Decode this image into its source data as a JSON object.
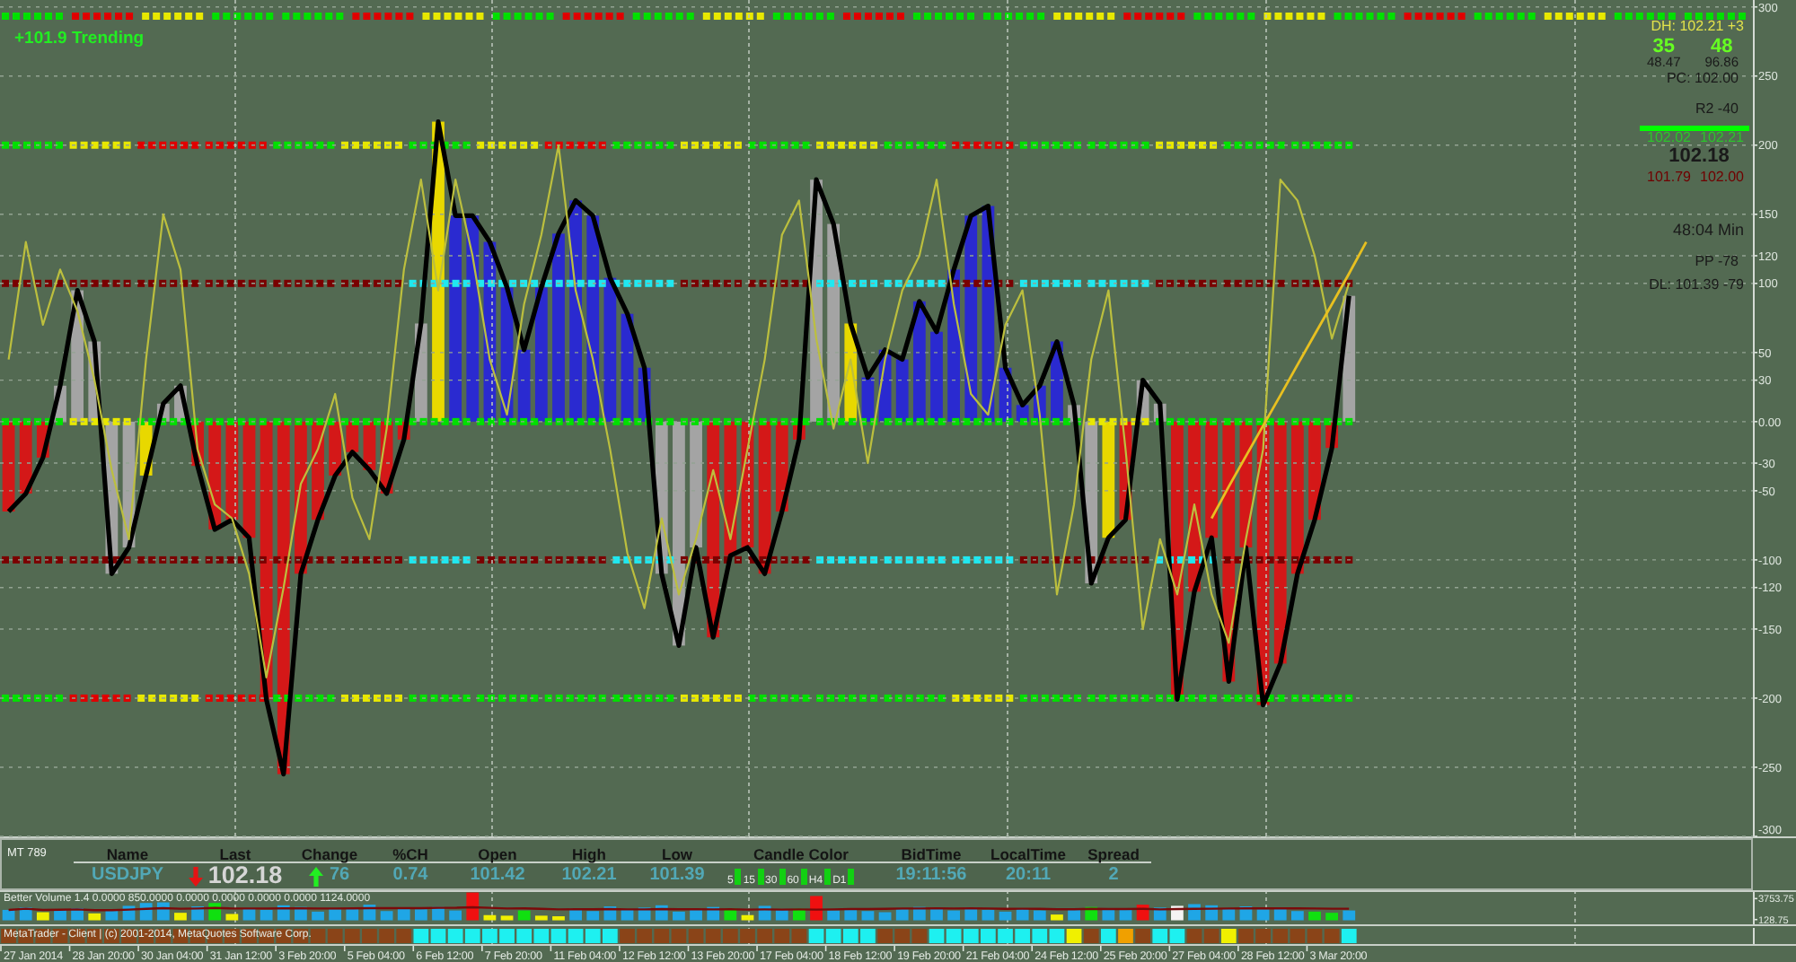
{
  "main_chart": {
    "status_text": "+101.9 Trending",
    "signal_strip": [
      {
        "color": "#00e000"
      },
      {
        "color": "#e00000"
      },
      {
        "color": "#e8e800"
      },
      {
        "color": "#00e000"
      },
      {
        "color": "#00e000"
      },
      {
        "color": "#e00000"
      },
      {
        "color": "#e8e800"
      },
      {
        "color": "#00e000"
      },
      {
        "color": "#e00000"
      },
      {
        "color": "#00e000"
      },
      {
        "color": "#e8e800"
      },
      {
        "color": "#00e000"
      },
      {
        "color": "#e00000"
      },
      {
        "color": "#00e000"
      },
      {
        "color": "#00e000"
      },
      {
        "color": "#e8e800"
      },
      {
        "color": "#e00000"
      },
      {
        "color": "#00e000"
      },
      {
        "color": "#e8e800"
      },
      {
        "color": "#00e000"
      },
      {
        "color": "#e00000"
      },
      {
        "color": "#00e000"
      },
      {
        "color": "#e8e800"
      },
      {
        "color": "#00e000"
      },
      {
        "color": "#00e000"
      }
    ],
    "level_strips": [
      {
        "segments": [
          {
            "color": "#00e000"
          },
          {
            "color": "#e8e800"
          },
          {
            "color": "#e00000"
          },
          {
            "color": "#e00000"
          },
          {
            "color": "#00e000"
          },
          {
            "color": "#e8e800"
          },
          {
            "color": "#00e000"
          },
          {
            "color": "#e8e800"
          },
          {
            "color": "#e00000"
          },
          {
            "color": "#00e000"
          },
          {
            "color": "#e8e800"
          },
          {
            "color": "#00e000"
          },
          {
            "color": "#e8e800"
          },
          {
            "color": "#00e000"
          },
          {
            "color": "#e00000"
          },
          {
            "color": "#00e000"
          },
          {
            "color": "#00e000"
          },
          {
            "color": "#e8e800"
          },
          {
            "color": "#00e000"
          },
          {
            "color": "#00e000"
          }
        ]
      },
      {
        "segments": [
          {
            "color": "#7a0000"
          },
          {
            "color": "#7a0000"
          },
          {
            "color": "#7a0000"
          },
          {
            "color": "#7a0000"
          },
          {
            "color": "#7a0000"
          },
          {
            "color": "#7a0000"
          },
          {
            "color": "#20e8f0"
          },
          {
            "color": "#20e8f0"
          },
          {
            "color": "#20e8f0"
          },
          {
            "color": "#20e8f0"
          },
          {
            "color": "#7a0000"
          },
          {
            "color": "#7a0000"
          },
          {
            "color": "#20e8f0"
          },
          {
            "color": "#20e8f0"
          },
          {
            "color": "#7a0000"
          },
          {
            "color": "#20e8f0"
          },
          {
            "color": "#20e8f0"
          },
          {
            "color": "#7a0000"
          },
          {
            "color": "#7a0000"
          },
          {
            "color": "#7a0000"
          }
        ]
      },
      {
        "segments": [
          {
            "color": "#00e000"
          },
          {
            "color": "#e8e800"
          },
          {
            "color": "#00e000"
          },
          {
            "color": "#00e000"
          },
          {
            "color": "#00e000"
          },
          {
            "color": "#00e000"
          },
          {
            "color": "#00e000"
          },
          {
            "color": "#00e000"
          },
          {
            "color": "#00e000"
          },
          {
            "color": "#00e000"
          },
          {
            "color": "#00e000"
          },
          {
            "color": "#00e000"
          },
          {
            "color": "#00e000"
          },
          {
            "color": "#00e000"
          },
          {
            "color": "#00e000"
          },
          {
            "color": "#00e000"
          },
          {
            "color": "#e8e800"
          },
          {
            "color": "#00e000"
          },
          {
            "color": "#00e000"
          },
          {
            "color": "#00e000"
          }
        ]
      },
      {
        "segments": [
          {
            "color": "#7a0000"
          },
          {
            "color": "#7a0000"
          },
          {
            "color": "#7a0000"
          },
          {
            "color": "#7a0000"
          },
          {
            "color": "#7a0000"
          },
          {
            "color": "#7a0000"
          },
          {
            "color": "#20e8f0"
          },
          {
            "color": "#7a0000"
          },
          {
            "color": "#7a0000"
          },
          {
            "color": "#20e8f0"
          },
          {
            "color": "#7a0000"
          },
          {
            "color": "#7a0000"
          },
          {
            "color": "#20e8f0"
          },
          {
            "color": "#20e8f0"
          },
          {
            "color": "#20e8f0"
          },
          {
            "color": "#7a0000"
          },
          {
            "color": "#7a0000"
          },
          {
            "color": "#20e8f0"
          },
          {
            "color": "#7a0000"
          },
          {
            "color": "#7a0000"
          }
        ]
      },
      {
        "segments": [
          {
            "color": "#00e000"
          },
          {
            "color": "#e00000"
          },
          {
            "color": "#e8e800"
          },
          {
            "color": "#e00000"
          },
          {
            "color": "#00e000"
          },
          {
            "color": "#e8e800"
          },
          {
            "color": "#00e000"
          },
          {
            "color": "#00e000"
          },
          {
            "color": "#00e000"
          },
          {
            "color": "#00e000"
          },
          {
            "color": "#e8e800"
          },
          {
            "color": "#00e000"
          },
          {
            "color": "#00e000"
          },
          {
            "color": "#00e000"
          },
          {
            "color": "#e8e800"
          },
          {
            "color": "#00e000"
          },
          {
            "color": "#00e000"
          },
          {
            "color": "#00e000"
          },
          {
            "color": "#00e000"
          },
          {
            "color": "#00e000"
          }
        ]
      }
    ],
    "histogram": {
      "bars": [
        {
          "color": "#d41818"
        },
        {
          "color": "#d41818"
        },
        {
          "color": "#d41818"
        },
        {
          "color": "#a4a4a4"
        },
        {
          "color": "#a4a4a4"
        },
        {
          "color": "#a4a4a4"
        },
        {
          "color": "#a4a4a4"
        },
        {
          "color": "#a4a4a4"
        },
        {
          "color": "#e8d800"
        },
        {
          "color": "#a4a4a4"
        },
        {
          "color": "#a4a4a4"
        },
        {
          "color": "#d41818"
        },
        {
          "color": "#d41818"
        },
        {
          "color": "#d41818"
        },
        {
          "color": "#d41818"
        },
        {
          "color": "#d41818"
        },
        {
          "color": "#d41818"
        },
        {
          "color": "#d41818"
        },
        {
          "color": "#d41818"
        },
        {
          "color": "#d41818"
        },
        {
          "color": "#d41818"
        },
        {
          "color": "#d41818"
        },
        {
          "color": "#d41818"
        },
        {
          "color": "#d41818"
        },
        {
          "color": "#a4a4a4"
        },
        {
          "color": "#e8d800"
        },
        {
          "color": "#2a2ad0"
        },
        {
          "color": "#2a2ad0"
        },
        {
          "color": "#2a2ad0"
        },
        {
          "color": "#2a2ad0"
        },
        {
          "color": "#2a2ad0"
        },
        {
          "color": "#2a2ad0"
        },
        {
          "color": "#2a2ad0"
        },
        {
          "color": "#2a2ad0"
        },
        {
          "color": "#2a2ad0"
        },
        {
          "color": "#2a2ad0"
        },
        {
          "color": "#2a2ad0"
        },
        {
          "color": "#2a2ad0"
        },
        {
          "color": "#a4a4a4"
        },
        {
          "color": "#a4a4a4"
        },
        {
          "color": "#a4a4a4"
        },
        {
          "color": "#d41818"
        },
        {
          "color": "#d41818"
        },
        {
          "color": "#d41818"
        },
        {
          "color": "#d41818"
        },
        {
          "color": "#d41818"
        },
        {
          "color": "#d41818"
        },
        {
          "color": "#a4a4a4"
        },
        {
          "color": "#a4a4a4"
        },
        {
          "color": "#e8d800"
        },
        {
          "color": "#2a2ad0"
        },
        {
          "color": "#2a2ad0"
        },
        {
          "color": "#2a2ad0"
        },
        {
          "color": "#2a2ad0"
        },
        {
          "color": "#2a2ad0"
        },
        {
          "color": "#2a2ad0"
        },
        {
          "color": "#2a2ad0"
        },
        {
          "color": "#2a2ad0"
        },
        {
          "color": "#2a2ad0"
        },
        {
          "color": "#2a2ad0"
        },
        {
          "color": "#2a2ad0"
        },
        {
          "color": "#2a2ad0"
        },
        {
          "color": "#a4a4a4"
        },
        {
          "color": "#a4a4a4"
        },
        {
          "color": "#e8d800"
        },
        {
          "color": "#d41818"
        },
        {
          "color": "#a4a4a4"
        },
        {
          "color": "#a4a4a4"
        },
        {
          "color": "#d41818"
        },
        {
          "color": "#d41818"
        },
        {
          "color": "#d41818"
        },
        {
          "color": "#d41818"
        },
        {
          "color": "#d41818"
        },
        {
          "color": "#d41818"
        },
        {
          "color": "#d41818"
        },
        {
          "color": "#d41818"
        },
        {
          "color": "#d41818"
        },
        {
          "color": "#d41818"
        },
        {
          "color": "#a4a4a4"
        }
      ]
    },
    "oscillator": {
      "chart_data": {
        "type": "line",
        "grid": true,
        "ylim": [
          -300,
          305
        ],
        "yticks": [
          300,
          250,
          200,
          150,
          120,
          100,
          50,
          30,
          {
            "value": 0,
            "label": "0.00"
          },
          -30,
          -50,
          -100,
          -120,
          -150,
          -200,
          -250,
          -300
        ],
        "categories": [
          null,
          null,
          null,
          null,
          null,
          null,
          null,
          null,
          null,
          null,
          null,
          null,
          null,
          null,
          null,
          null,
          null,
          null,
          null,
          null,
          null,
          null,
          null,
          null,
          null,
          null,
          null,
          null,
          null,
          null,
          null,
          null,
          null,
          null,
          null,
          null,
          null,
          null,
          null,
          null,
          null,
          null,
          null,
          null,
          null,
          null,
          null,
          null,
          null,
          null,
          null,
          null,
          null,
          null,
          null,
          null,
          null,
          null,
          null,
          null,
          null,
          null,
          null,
          null,
          null,
          null,
          null,
          null,
          null,
          null,
          null,
          null,
          null,
          null,
          null,
          null,
          null,
          null,
          null,
          null,
          null,
          null,
          null,
          null,
          null,
          null,
          null,
          null,
          null,
          null,
          null,
          null,
          null,
          null,
          null,
          null,
          null,
          null,
          null,
          null,
          null,
          null
        ],
        "series": [
          {
            "color": "#000000",
            "values": [
              -65,
              -52,
              -26,
              26,
              95,
              58,
              -110,
              -91,
              -39,
              13,
              26,
              -32,
              -78,
              -71,
              -84,
              -201,
              -255,
              -110,
              -71,
              -39,
              -22,
              -35,
              -52,
              -13,
              71,
              217,
              149,
              149,
              130,
              97,
              52,
              97,
              136,
              160,
              149,
              104,
              78,
              39,
              -110,
              -162,
              -91,
              -156,
              -97,
              -91,
              -110,
              -65,
              -13,
              175,
              143,
              71,
              32,
              52,
              45,
              87,
              65,
              110,
              149,
              156,
              39,
              12,
              26,
              58,
              12,
              -117,
              -84,
              -71,
              30,
              13,
              -201,
              -123,
              -84,
              -188,
              -91,
              -205,
              -175,
              -110,
              -71,
              -19,
              91,
              null,
              null,
              null,
              null,
              null,
              null,
              null,
              null,
              null,
              null,
              null,
              null,
              null,
              null,
              null,
              null,
              null,
              null,
              null,
              null,
              null,
              null,
              null
            ]
          },
          {
            "color": "#bcbf3e",
            "values": [
              45,
              130,
              70,
              110,
              80,
              30,
              -35,
              -85,
              45,
              150,
              110,
              -20,
              -60,
              -70,
              -110,
              -185,
              -120,
              -45,
              -20,
              20,
              -55,
              -85,
              -5,
              110,
              175,
              95,
              175,
              120,
              45,
              5,
              85,
              135,
              200,
              95,
              45,
              -20,
              -95,
              -135,
              -70,
              -125,
              -85,
              -35,
              -85,
              -20,
              45,
              135,
              160,
              60,
              -5,
              45,
              -30,
              45,
              95,
              120,
              175,
              85,
              20,
              5,
              70,
              95,
              5,
              -125,
              -60,
              45,
              95,
              -20,
              -150,
              -85,
              -125,
              -60,
              -125,
              -160,
              -85,
              -20,
              175,
              160,
              120,
              60,
              100,
              null,
              null,
              null,
              null,
              null,
              null,
              null,
              null,
              null,
              null,
              null,
              null,
              null,
              null,
              null,
              null,
              null,
              null,
              null,
              null,
              null,
              null,
              null
            ]
          },
          {
            "color": "#e8c020",
            "values": [
              null,
              null,
              null,
              null,
              null,
              null,
              null,
              null,
              null,
              null,
              null,
              null,
              null,
              null,
              null,
              null,
              null,
              null,
              null,
              null,
              null,
              null,
              null,
              null,
              null,
              null,
              null,
              null,
              null,
              null,
              null,
              null,
              null,
              null,
              null,
              null,
              null,
              null,
              null,
              null,
              null,
              null,
              null,
              null,
              null,
              null,
              null,
              null,
              null,
              null,
              null,
              null,
              null,
              null,
              null,
              null,
              null,
              null,
              null,
              null,
              null,
              null,
              null,
              null,
              null,
              null,
              null,
              null,
              null,
              null,
              -70,
              -47,
              -25,
              -3,
              19,
              41,
              63,
              85,
              107,
              130,
              null,
              null,
              null,
              null,
              null,
              null,
              null,
              null,
              null,
              null,
              null,
              null,
              null,
              null,
              null,
              null,
              null,
              null,
              null,
              null,
              null,
              null
            ]
          }
        ]
      }
    },
    "readout": {
      "day_high": "DH: 102.21 +3",
      "counters": [
        {
          "value": "35",
          "detail": "48.47"
        },
        {
          "value": "48",
          "detail": "96.86"
        }
      ],
      "previous_close": "PC: 102.00",
      "resistance": "R2 -40",
      "high_pair": [
        "102.02",
        "102.21"
      ],
      "price": "102.18",
      "low_pair": [
        "101.79",
        "102.00"
      ],
      "countdown": "48:04 Min",
      "pivot": "PP -78",
      "day_low": "DL: 101.39 -79"
    }
  },
  "quote_panel": {
    "terminal": "MT 789",
    "columns": [
      "Name",
      "Last",
      "Change",
      "%CH",
      "Open",
      "High",
      "Low",
      "Candle Color",
      "BidTime",
      "LocalTime",
      "Spread"
    ],
    "symbol": "USDJPY",
    "last_up": false,
    "last": "102.18",
    "change_up": true,
    "change": "76",
    "percent_change": "0.74",
    "open": "101.42",
    "high": "102.21",
    "low": "101.39",
    "candles": [
      {
        "label": "5",
        "color": "#12d012"
      },
      {
        "label": "15",
        "color": "#12d012"
      },
      {
        "label": "30",
        "color": "#12d012"
      },
      {
        "label": "60",
        "color": "#12d012"
      },
      {
        "label": "H4",
        "color": "#12d012"
      },
      {
        "label": "D1",
        "color": "#12d012"
      }
    ],
    "bid_time": "19:11:56",
    "local_time": "20:11",
    "spread": "2"
  },
  "volume_chart": {
    "title": "Better Volume 1.4 0.0000 850.0000 0.0000 0.0000 0.0000 0.0000 1124.0000",
    "chart_data": {
      "type": "bar",
      "stacked": true,
      "grid": true,
      "ylim": [
        -1000,
        5200
      ],
      "yticks": [
        3753.75,
        128.75
      ],
      "series": [
        {
          "color": "#1fa6e6",
          "values": [
            1800,
            2200,
            null,
            1900,
            2100,
            null,
            1700,
            2500,
            3000,
            3100,
            null,
            2400,
            null,
            null,
            2000,
            1800,
            2600,
            2300,
            1500,
            1900,
            2200,
            2700,
            1600,
            2100,
            1900,
            2300,
            1700,
            null,
            null,
            null,
            null,
            null,
            null,
            2100,
            1600,
            2400,
            1800,
            2200,
            2600,
            1500,
            2000,
            2300,
            null,
            null,
            2500,
            1900,
            null,
            null,
            1700,
            2100,
            1600,
            1400,
            1900,
            2300,
            2000,
            1700,
            2200,
            1800,
            1500,
            2000,
            1700,
            null,
            1900,
            null,
            1800,
            2000,
            null,
            2200,
            null,
            2800,
            2600,
            2100,
            2400,
            1900,
            2200,
            1600,
            null,
            null,
            1700,
            null,
            null,
            null,
            null,
            null,
            null,
            null,
            null,
            null,
            null,
            null,
            null,
            null,
            null,
            null,
            null,
            null,
            null,
            null,
            null,
            null,
            null,
            null
          ]
        },
        {
          "color": "#f0f000",
          "values": [
            null,
            null,
            1400,
            null,
            null,
            1200,
            null,
            null,
            null,
            null,
            1300,
            null,
            null,
            1100,
            null,
            null,
            null,
            null,
            null,
            null,
            null,
            null,
            null,
            null,
            null,
            null,
            null,
            null,
            900,
            800,
            null,
            800,
            700,
            null,
            null,
            null,
            null,
            null,
            null,
            null,
            null,
            null,
            null,
            900,
            null,
            null,
            null,
            null,
            null,
            null,
            null,
            null,
            null,
            null,
            null,
            null,
            null,
            null,
            null,
            null,
            null,
            1000,
            null,
            null,
            null,
            null,
            null,
            null,
            null,
            null,
            null,
            null,
            null,
            null,
            null,
            null,
            null,
            null,
            null,
            null,
            null,
            null,
            null,
            null,
            null,
            null,
            null,
            null,
            null,
            null,
            null,
            null,
            null,
            null,
            null,
            null,
            null,
            null,
            null,
            null,
            null,
            null
          ]
        },
        {
          "color": "#10e010",
          "values": [
            null,
            null,
            null,
            null,
            null,
            null,
            null,
            null,
            null,
            null,
            null,
            null,
            3000,
            null,
            null,
            null,
            null,
            null,
            null,
            null,
            null,
            null,
            null,
            null,
            null,
            null,
            null,
            null,
            null,
            null,
            1700,
            null,
            null,
            null,
            null,
            null,
            null,
            null,
            null,
            null,
            null,
            null,
            2100,
            null,
            null,
            null,
            2000,
            null,
            null,
            null,
            null,
            null,
            null,
            null,
            null,
            null,
            null,
            null,
            null,
            null,
            null,
            null,
            null,
            2300,
            null,
            null,
            null,
            null,
            null,
            null,
            null,
            null,
            null,
            null,
            null,
            null,
            1500,
            1300,
            null,
            null,
            null,
            null,
            null,
            null,
            null,
            null,
            null,
            null,
            null,
            null,
            null,
            null,
            null,
            null,
            null,
            null,
            null,
            null,
            null,
            null,
            null
          ]
        },
        {
          "color": "#f01010",
          "values": [
            null,
            null,
            null,
            null,
            null,
            null,
            null,
            null,
            null,
            null,
            null,
            null,
            null,
            null,
            null,
            null,
            null,
            null,
            null,
            null,
            null,
            null,
            null,
            null,
            null,
            null,
            null,
            4800,
            null,
            null,
            null,
            null,
            null,
            null,
            null,
            null,
            null,
            null,
            null,
            null,
            null,
            null,
            null,
            null,
            null,
            null,
            null,
            4200,
            null,
            null,
            null,
            null,
            null,
            null,
            null,
            null,
            null,
            null,
            null,
            null,
            null,
            null,
            null,
            null,
            null,
            null,
            2700,
            null,
            null,
            null,
            null,
            null,
            null,
            null,
            null,
            null,
            null,
            null,
            null,
            null,
            null,
            null,
            null,
            null,
            null,
            null,
            null,
            null,
            null,
            null,
            null,
            null,
            null,
            null,
            null,
            null,
            null,
            null,
            null,
            null,
            null,
            null
          ]
        },
        {
          "color": "#f4f4f4",
          "values": [
            null,
            null,
            null,
            null,
            null,
            null,
            null,
            null,
            null,
            null,
            null,
            null,
            null,
            null,
            null,
            null,
            null,
            null,
            null,
            null,
            null,
            null,
            null,
            null,
            null,
            null,
            null,
            null,
            null,
            null,
            null,
            null,
            null,
            null,
            null,
            null,
            null,
            null,
            null,
            null,
            null,
            null,
            null,
            null,
            null,
            null,
            null,
            null,
            null,
            null,
            null,
            null,
            null,
            null,
            null,
            null,
            null,
            null,
            null,
            null,
            null,
            null,
            null,
            null,
            null,
            null,
            null,
            null,
            2500,
            null,
            null,
            null,
            null,
            null,
            null,
            null,
            null,
            null,
            null,
            null,
            null,
            null,
            null,
            null,
            null,
            null,
            null,
            null,
            null,
            null,
            null,
            null,
            null,
            null,
            null,
            null,
            null,
            null,
            null,
            null,
            null,
            null
          ]
        }
      ]
    }
  },
  "color_strip": {
    "caption": "MetaTrader - Client | (c) 2001-2014, MetaQuotes Software Corp.",
    "blocks": [
      {
        "color": "#8a4418"
      },
      {
        "color": "#8a4418"
      },
      {
        "color": "#8a4418"
      },
      {
        "color": "#8a4418"
      },
      {
        "color": "#8a4418"
      },
      {
        "color": "#8a4418"
      },
      {
        "color": "#8a4418"
      },
      {
        "color": "#8a4418"
      },
      {
        "color": "#8a4418"
      },
      {
        "color": "#8a4418"
      },
      {
        "color": "#8a4418"
      },
      {
        "color": "#8a4418"
      },
      {
        "color": "#8a4418"
      },
      {
        "color": "#8a4418"
      },
      {
        "color": "#8a4418"
      },
      {
        "color": "#8a4418"
      },
      {
        "color": "#8a4418"
      },
      {
        "color": "#8a4418"
      },
      {
        "color": "#8a4418"
      },
      {
        "color": "#8a4418"
      },
      {
        "color": "#8a4418"
      },
      {
        "color": "#8a4418"
      },
      {
        "color": "#8a4418"
      },
      {
        "color": "#8a4418"
      },
      {
        "color": "#1ef0f0"
      },
      {
        "color": "#1ef0f0"
      },
      {
        "color": "#1ef0f0"
      },
      {
        "color": "#1ef0f0"
      },
      {
        "color": "#1ef0f0"
      },
      {
        "color": "#1ef0f0"
      },
      {
        "color": "#1ef0f0"
      },
      {
        "color": "#1ef0f0"
      },
      {
        "color": "#1ef0f0"
      },
      {
        "color": "#1ef0f0"
      },
      {
        "color": "#1ef0f0"
      },
      {
        "color": "#1ef0f0"
      },
      {
        "color": "#8a4418"
      },
      {
        "color": "#8a4418"
      },
      {
        "color": "#8a4418"
      },
      {
        "color": "#8a4418"
      },
      {
        "color": "#8a4418"
      },
      {
        "color": "#8a4418"
      },
      {
        "color": "#8a4418"
      },
      {
        "color": "#8a4418"
      },
      {
        "color": "#8a4418"
      },
      {
        "color": "#8a4418"
      },
      {
        "color": "#8a4418"
      },
      {
        "color": "#1ef0f0"
      },
      {
        "color": "#1ef0f0"
      },
      {
        "color": "#1ef0f0"
      },
      {
        "color": "#1ef0f0"
      },
      {
        "color": "#8a4418"
      },
      {
        "color": "#8a4418"
      },
      {
        "color": "#8a4418"
      },
      {
        "color": "#1ef0f0"
      },
      {
        "color": "#1ef0f0"
      },
      {
        "color": "#1ef0f0"
      },
      {
        "color": "#1ef0f0"
      },
      {
        "color": "#1ef0f0"
      },
      {
        "color": "#1ef0f0"
      },
      {
        "color": "#1ef0f0"
      },
      {
        "color": "#1ef0f0"
      },
      {
        "color": "#f0f000"
      },
      {
        "color": "#8a4418"
      },
      {
        "color": "#1ef0f0"
      },
      {
        "color": "#f0a000"
      },
      {
        "color": "#8a4418"
      },
      {
        "color": "#1ef0f0"
      },
      {
        "color": "#1ef0f0"
      },
      {
        "color": "#8a4418"
      },
      {
        "color": "#8a4418"
      },
      {
        "color": "#f0f000"
      },
      {
        "color": "#8a4418"
      },
      {
        "color": "#8a4418"
      },
      {
        "color": "#8a4418"
      },
      {
        "color": "#8a4418"
      },
      {
        "color": "#8a4418"
      },
      {
        "color": "#8a4418"
      },
      {
        "color": "#1ef0f0"
      }
    ]
  },
  "time_axis": {
    "labels": [
      "27 Jan 2014",
      "28 Jan 20:00",
      "30 Jan 04:00",
      "31 Jan 12:00",
      "3 Feb 20:00",
      "5 Feb 04:00",
      "6 Feb 12:00",
      "7 Feb 20:00",
      "11 Feb 04:00",
      "12 Feb 12:00",
      "13 Feb 20:00",
      "17 Feb 04:00",
      "18 Feb 12:00",
      "19 Feb 20:00",
      "21 Feb 04:00",
      "24 Feb 12:00",
      "25 Feb 20:00",
      "27 Feb 04:00",
      "28 Feb 12:00",
      "3 Mar 20:00"
    ]
  }
}
